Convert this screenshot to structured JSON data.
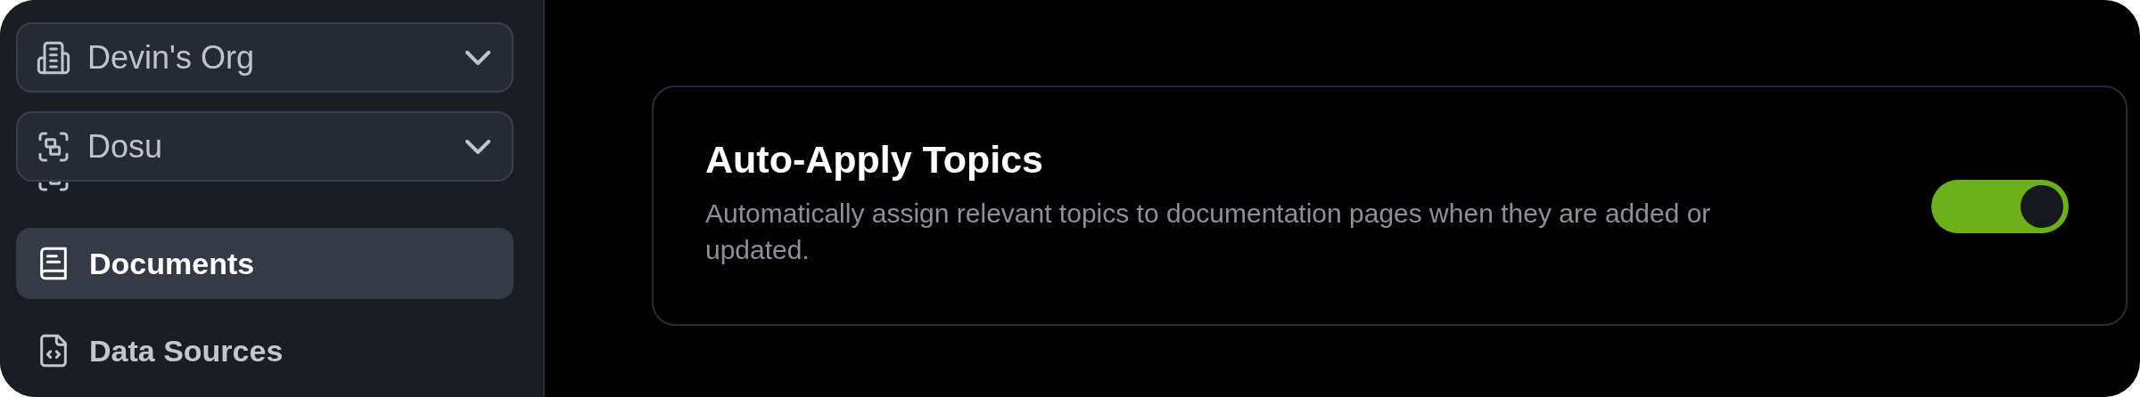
{
  "switchers": [
    {
      "label": "Devin's Org",
      "kind": "org"
    },
    {
      "label": "Dosu",
      "kind": "space"
    }
  ],
  "nav": [
    {
      "kind": "space",
      "selected": false
    },
    {
      "label": "Documents",
      "kind": "book",
      "selected": true
    },
    {
      "label": "Data Sources",
      "kind": "file-code",
      "selected": false
    }
  ],
  "setting": {
    "title": "Auto-Apply Topics",
    "description": "Automatically assign relevant topics to documentation pages when they are added or updated.",
    "on": true
  }
}
